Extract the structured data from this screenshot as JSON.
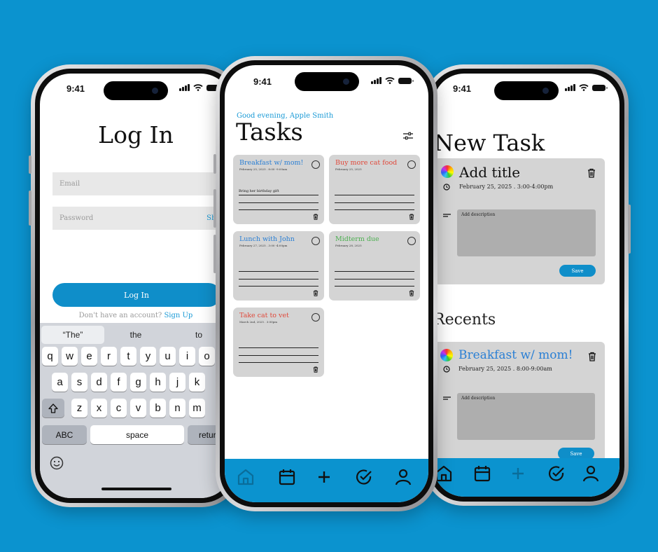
{
  "colors": {
    "background": "#0b93cf",
    "accent": "#0f8ec9",
    "card": "#d4d4d4",
    "blue_text": "#2a7fd4",
    "red_text": "#e0483a",
    "green_text": "#4caf50"
  },
  "status_bar": {
    "time": "9:41"
  },
  "login": {
    "title": "Log In",
    "email_placeholder": "Email",
    "password_placeholder": "Password",
    "show_label": "Show",
    "button_label": "Log In",
    "no_account_text": "Don't have an account?",
    "signup_link": "Sign Up",
    "keyboard": {
      "suggestions": [
        "“The”",
        "the",
        "to"
      ],
      "row1": [
        "q",
        "w",
        "e",
        "r",
        "t",
        "y",
        "u",
        "i",
        "o"
      ],
      "row2": [
        "a",
        "s",
        "d",
        "f",
        "g",
        "h",
        "j",
        "k"
      ],
      "row3": [
        "z",
        "x",
        "c",
        "v",
        "b",
        "n",
        "m"
      ],
      "abc_label": "ABC",
      "space_label": "space",
      "return_label": "return",
      "shift_icon": "shift-icon",
      "emoji_icon": "emoji-icon"
    }
  },
  "tasks": {
    "greeting": "Good evening, Apple Smith",
    "title": "Tasks",
    "filter_icon": "sliders-icon",
    "cards": [
      {
        "title": "Breakfast w/ mom!",
        "date": "February 25, 2025 . 8:00 -9:00am",
        "note": "Bring her birthday gift",
        "color": "#2a7fd4"
      },
      {
        "title": "Buy more cat food",
        "date": "February 25, 2025",
        "note": "",
        "color": "#e0483a"
      },
      {
        "title": "Lunch with John",
        "date": "February 27, 2025 . 3:00 -4:00pm",
        "note": "",
        "color": "#2a7fd4"
      },
      {
        "title": "Midterm due",
        "date": "February 28, 2025",
        "note": "",
        "color": "#4caf50"
      },
      {
        "title": "Take cat to vet",
        "date": "March 2nd, 2025 . 3:00pm",
        "note": "",
        "color": "#e0483a"
      }
    ],
    "tabbar": [
      "home-icon",
      "calendar-icon",
      "plus-icon",
      "check-circle-icon",
      "user-icon"
    ]
  },
  "new_task": {
    "title": "New Task",
    "form": {
      "title_placeholder": "Add title",
      "datetime": "February 25, 2025 . 3:00-4:00pm",
      "description_placeholder": "Add description",
      "save_label": "Save"
    },
    "recents_heading": "Recents",
    "recent": {
      "title": "Breakfast w/ mom!",
      "datetime": "February 25, 2025 . 8:00-9:00am",
      "description_placeholder": "Add description",
      "save_label": "Save"
    }
  }
}
